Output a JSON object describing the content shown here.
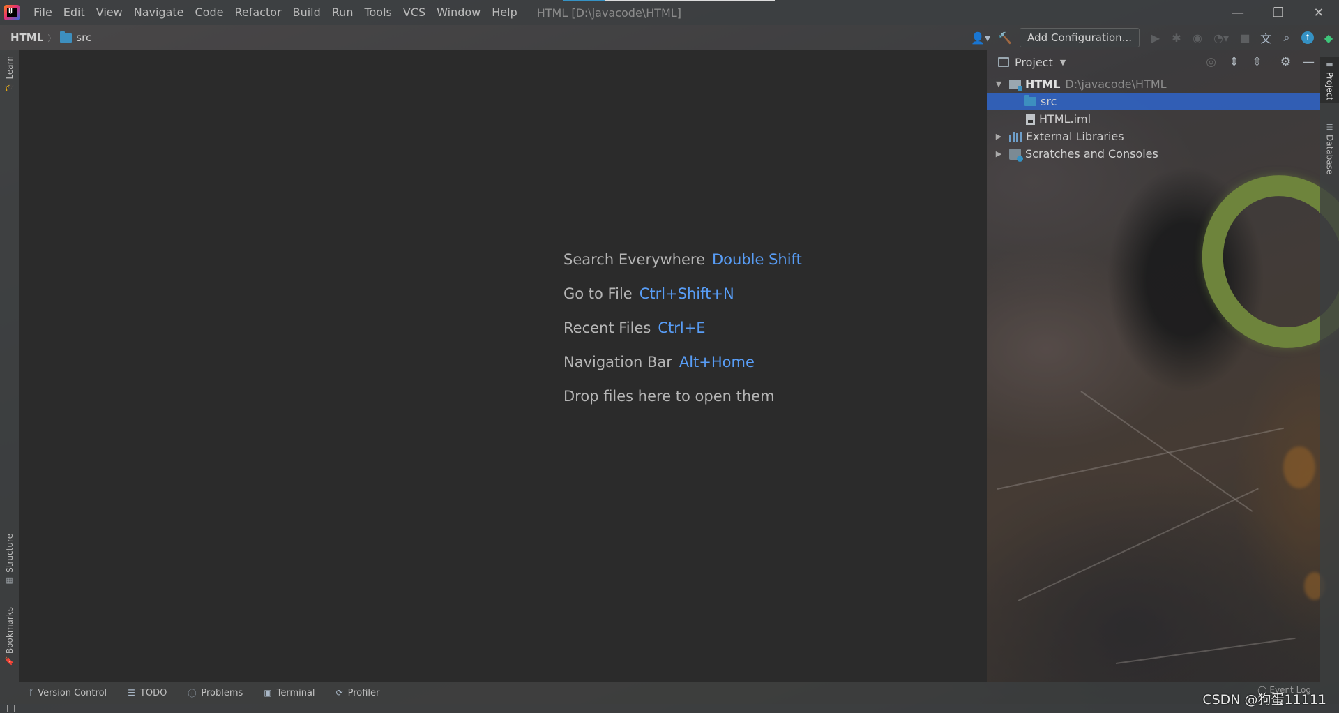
{
  "app": {
    "logo_text": "IJ",
    "window_title": "HTML [D:\\javacode\\HTML]"
  },
  "menu": [
    {
      "mnemonic": "F",
      "rest": "ile"
    },
    {
      "mnemonic": "E",
      "rest": "dit"
    },
    {
      "mnemonic": "V",
      "rest": "iew"
    },
    {
      "mnemonic": "N",
      "rest": "avigate"
    },
    {
      "mnemonic": "C",
      "rest": "ode"
    },
    {
      "mnemonic": "R",
      "rest": "efactor"
    },
    {
      "mnemonic": "B",
      "rest": "uild"
    },
    {
      "mnemonic": "R",
      "rest": "un"
    },
    {
      "mnemonic": "T",
      "rest": "ools"
    },
    {
      "mnemonic": "",
      "rest": "VCS"
    },
    {
      "mnemonic": "W",
      "rest": "indow"
    },
    {
      "mnemonic": "H",
      "rest": "elp"
    }
  ],
  "window_controls": {
    "minimize": "—",
    "restore": "❐",
    "close": "✕"
  },
  "breadcrumb": {
    "project": "HTML",
    "folder": "src"
  },
  "toolbar": {
    "add_configuration": "Add Configuration...",
    "icons": [
      "user-icon",
      "build-hammer-icon",
      "run-icon",
      "debug-icon",
      "coverage-icon",
      "profile-icon",
      "stop-icon",
      "translate-icon",
      "search-icon",
      "update-icon",
      "toolbox-icon"
    ]
  },
  "left_tabs": {
    "learn": "Learn",
    "structure": "Structure",
    "bookmarks": "Bookmarks"
  },
  "right_tabs": {
    "project": "Project",
    "database": "Database"
  },
  "editor_hints": [
    {
      "label": "Search Everywhere",
      "shortcut": "Double Shift"
    },
    {
      "label": "Go to File",
      "shortcut": "Ctrl+Shift+N"
    },
    {
      "label": "Recent Files",
      "shortcut": "Ctrl+E"
    },
    {
      "label": "Navigation Bar",
      "shortcut": "Alt+Home"
    },
    {
      "label": "Drop files here to open them",
      "shortcut": ""
    }
  ],
  "project_panel": {
    "title": "Project",
    "tree": {
      "root_name": "HTML",
      "root_path": "D:\\javacode\\HTML",
      "src": "src",
      "iml": "HTML.iml",
      "external_libraries": "External Libraries",
      "scratches": "Scratches and Consoles"
    }
  },
  "bottom_tools": {
    "version_control": "Version Control",
    "todo": "TODO",
    "problems": "Problems",
    "terminal": "Terminal",
    "profiler": "Profiler"
  },
  "status": {
    "event_log": "Event Log",
    "watermark": "CSDN @狗蛋11111"
  },
  "colors": {
    "accent": "#589df6",
    "selection": "#2f65ca",
    "editor_bg": "#2b2b2b"
  }
}
